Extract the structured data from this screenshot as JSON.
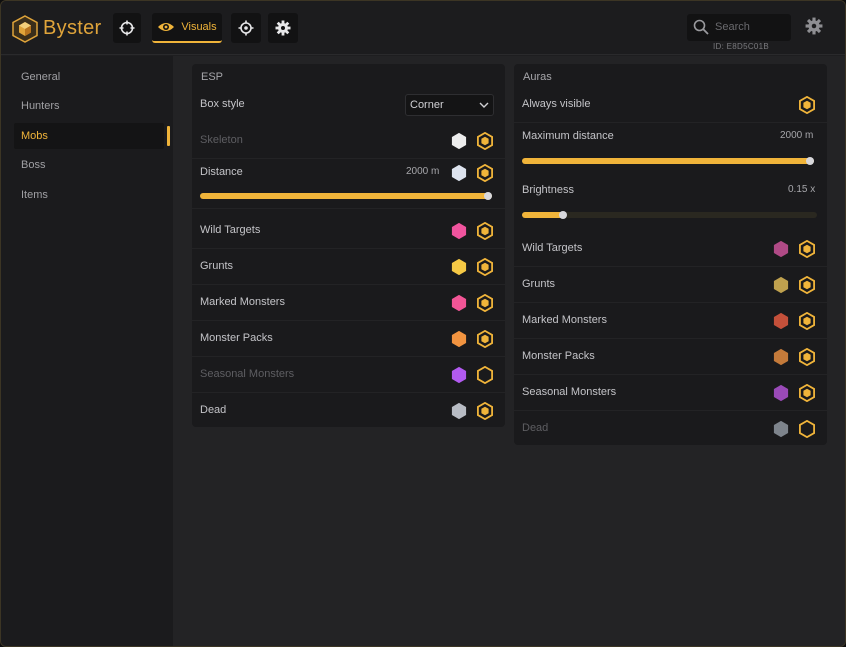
{
  "app": {
    "name": "Byster",
    "id_text": "ID: E8D5C01B"
  },
  "nav": {
    "visuals_label": "Visuals"
  },
  "search": {
    "placeholder": "Search"
  },
  "accent": "#f0b43a",
  "sidebar": {
    "items": [
      {
        "label": "General"
      },
      {
        "label": "Hunters"
      },
      {
        "label": "Mobs"
      },
      {
        "label": "Boss"
      },
      {
        "label": "Items"
      }
    ],
    "active": "Mobs"
  },
  "esp": {
    "title": "ESP",
    "box_style": {
      "label": "Box style",
      "value": "Corner"
    },
    "skeleton": {
      "label": "Skeleton",
      "color": "#ededed",
      "enabled": true
    },
    "distance": {
      "label": "Distance",
      "value": "2000 m",
      "color": "#dde3ee",
      "enabled": true,
      "slider_fraction": 1.0
    },
    "items": [
      {
        "label": "Wild Targets",
        "color": "#f0549e",
        "enabled": true
      },
      {
        "label": "Grunts",
        "color": "#f6c945",
        "enabled": true
      },
      {
        "label": "Marked Monsters",
        "color": "#f25596",
        "enabled": true
      },
      {
        "label": "Monster Packs",
        "color": "#f29440",
        "enabled": true
      },
      {
        "label": "Seasonal Monsters",
        "color": "#b25af0",
        "enabled": false
      },
      {
        "label": "Dead",
        "color": "#b8bcc4",
        "enabled": true
      }
    ]
  },
  "auras": {
    "title": "Auras",
    "always_visible": {
      "label": "Always visible",
      "enabled": true
    },
    "max_distance": {
      "label": "Maximum distance",
      "value": "2000 m",
      "slider_fraction": 1.0
    },
    "brightness": {
      "label": "Brightness",
      "value": "0.15 x",
      "slider_fraction": 0.14
    },
    "items": [
      {
        "label": "Wild Targets",
        "color": "#b04a86",
        "enabled": true
      },
      {
        "label": "Grunts",
        "color": "#bfa14e",
        "enabled": true
      },
      {
        "label": "Marked Monsters",
        "color": "#c4503a",
        "enabled": true
      },
      {
        "label": "Monster Packs",
        "color": "#c47a3a",
        "enabled": true
      },
      {
        "label": "Seasonal Monsters",
        "color": "#9a4ab8",
        "enabled": true
      },
      {
        "label": "Dead",
        "color": "#7e848c",
        "enabled": false
      }
    ]
  }
}
